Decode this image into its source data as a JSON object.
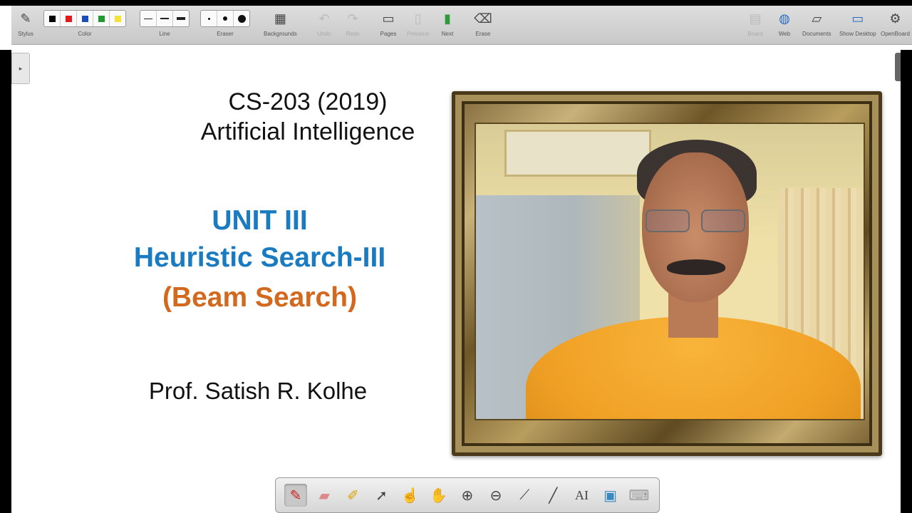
{
  "toolbar": {
    "groups": {
      "stylus": "Stylus",
      "color": "Color",
      "line": "Line",
      "eraser": "Eraser",
      "backgrounds": "Backgrounds",
      "undo": "Undo",
      "redo": "Redo",
      "pages": "Pages",
      "previous": "Previous",
      "next": "Next",
      "erase": "Erase",
      "board": "Board",
      "web": "Web",
      "documents": "Documents",
      "show_desktop": "Show Desktop",
      "openboard": "OpenBoard"
    },
    "colors": [
      "#000000",
      "#e01b1b",
      "#1a4fb8",
      "#1f9a2e",
      "#f2e23a"
    ],
    "icons": {
      "stylus": "stylus-pen-icon",
      "backgrounds": "keyboard-icon",
      "undo": "undo-arrow-icon",
      "redo": "redo-arrow-icon",
      "pages": "add-page-icon",
      "previous": "previous-page-icon",
      "next": "next-page-icon",
      "erase": "erase-board-icon",
      "board": "board-icon",
      "web": "globe-icon",
      "documents": "folder-icon",
      "show_desktop": "monitor-icon",
      "openboard": "settings-gear-icon"
    }
  },
  "slide": {
    "course_code": "CS-203 (2019)",
    "course_name": "Artificial Intelligence",
    "unit": "UNIT III",
    "topic": "Heuristic Search-III",
    "subtopic": "(Beam Search)",
    "professor": "Prof. Satish R. Kolhe",
    "colors": {
      "unit_blue": "#1a7bc1",
      "subtopic_orange": "#d2691e"
    }
  },
  "bottom_tools": [
    "pen-icon",
    "eraser-icon",
    "highlighter-icon",
    "selector-arrow-icon",
    "laser-pointer-icon",
    "hand-icon",
    "zoom-in-icon",
    "zoom-out-icon",
    "pointer-stick-icon",
    "line-icon",
    "text-icon",
    "capture-icon",
    "virtual-keyboard-icon"
  ]
}
